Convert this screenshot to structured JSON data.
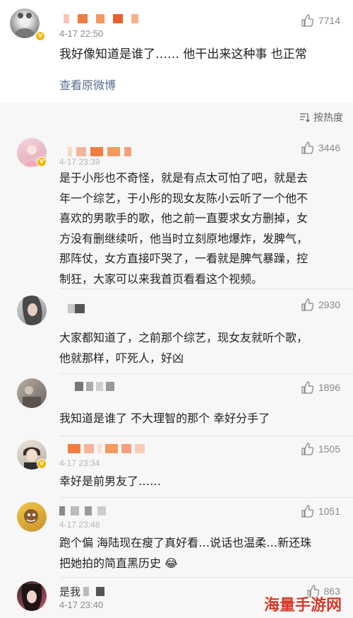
{
  "post": {
    "time": "4-17 22:50",
    "likes": "7714",
    "text": "我好像知道是谁了…… 他干出来这种事 也正常",
    "view_original": "查看原微博"
  },
  "sort": {
    "label": "按热度",
    "icon": "sort-icon"
  },
  "comments": [
    {
      "likes": "3446",
      "time": "4-17 23:39",
      "lines": [
        "是于小彤也不奇怪，就是有点太可怕了吧，就是去",
        "年一个综艺，于小彤的现女友陈小云听了一个他不",
        "喜欢的男歌手的歌，他之前一直要求女方删掉，女",
        "方没有删继续听，他当时立刻原地爆炸，发脾气，",
        "那阵仗，女方直接吓哭了，一看就是脾气暴躁，控",
        "制狂，大家可以来我首页看看这个视频。"
      ]
    },
    {
      "likes": "2930",
      "lines": [
        "大家都知道了，之前那个综艺，现女友就听个歌，",
        "他就那样，吓死人，好凶"
      ]
    },
    {
      "likes": "1896",
      "lines": [
        "我知道是谁了 不大理智的那个 幸好分手了"
      ]
    },
    {
      "likes": "1505",
      "time": "4-17 23:34",
      "lines": [
        "幸好是前男友了……"
      ]
    },
    {
      "likes": "1051",
      "time": "4-17 23:48",
      "lines": [
        "跑个偏  海陆现在瘦了真好看…说话也温柔…新还珠",
        "把她拍的简直黑历史 😂"
      ]
    },
    {
      "likes": "863",
      "name_prefix": "是我",
      "time": "4-17 23:40",
      "lines": [
        "……"
      ]
    }
  ],
  "watermark": "海量手游网",
  "colors": {
    "accent": "#f5b400",
    "link": "#5a6f8f",
    "watermark": "#d43a2a"
  }
}
